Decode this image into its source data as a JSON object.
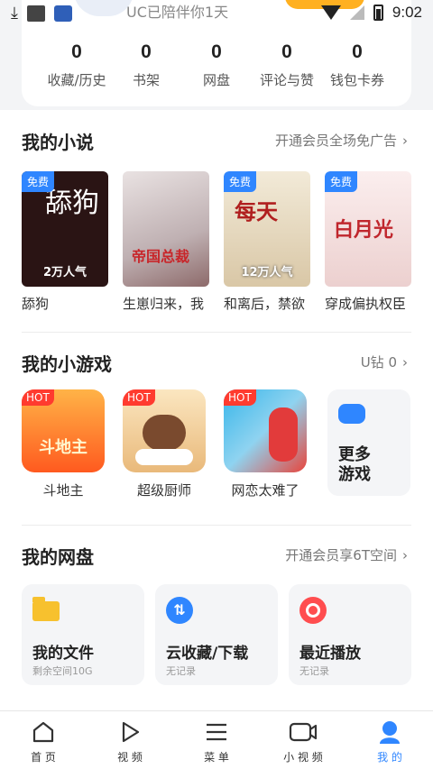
{
  "status_bar": {
    "time": "9:02",
    "app_slogan": "UC已陪伴你1天"
  },
  "stats": [
    {
      "value": "0",
      "label": "收藏/历史"
    },
    {
      "value": "0",
      "label": "书架"
    },
    {
      "value": "0",
      "label": "网盘"
    },
    {
      "value": "0",
      "label": "评论与赞"
    },
    {
      "value": "0",
      "label": "钱包卡券"
    }
  ],
  "novels": {
    "title": "我的小说",
    "more": "开通会员全场免广告",
    "books": [
      {
        "title": "舔狗",
        "badge": "免费",
        "popularity": "2万人气",
        "cover_text": "舔狗",
        "color": "#2a1414"
      },
      {
        "title": "生崽归来，我",
        "badge": "",
        "popularity": "",
        "cover_text": "帝国总裁",
        "color": "#d9cfd0"
      },
      {
        "title": "和离后，禁欲",
        "badge": "免费",
        "popularity": "12万人气",
        "cover_text": "每天",
        "color": "#efe6d6"
      },
      {
        "title": "穿成偏执权臣",
        "badge": "免费",
        "popularity": "",
        "cover_text": "白月光",
        "color": "#f4e3e2"
      }
    ]
  },
  "games": {
    "title": "我的小游戏",
    "more": "U钻 0",
    "items": [
      {
        "name": "斗地主",
        "tag": "HOT",
        "icon_text": "斗地主",
        "color": "#ff7a1a"
      },
      {
        "name": "超级厨师",
        "tag": "HOT",
        "icon_text": "",
        "color": "#f6e0b8"
      },
      {
        "name": "网恋太难了",
        "tag": "HOT",
        "icon_text": "",
        "color": "#3ab3e8"
      }
    ],
    "more_games": "更多游戏"
  },
  "cloud": {
    "title": "我的网盘",
    "more": "开通会员享6T空间",
    "tiles": [
      {
        "name": "我的文件",
        "sub": "剩余空间10G",
        "icon": "folder-icon",
        "color": "#f7c12e"
      },
      {
        "name": "云收藏/下载",
        "sub": "无记录",
        "icon": "cloud-download-icon",
        "color": "#2f86ff"
      },
      {
        "name": "最近播放",
        "sub": "无记录",
        "icon": "recent-play-icon",
        "color": "#ff4d4f"
      }
    ]
  },
  "nav": [
    {
      "label": "首 页",
      "icon": "home-icon"
    },
    {
      "label": "视 频",
      "icon": "play-icon"
    },
    {
      "label": "菜 单",
      "icon": "menu-icon"
    },
    {
      "label": "小 视 频",
      "icon": "camera-icon"
    },
    {
      "label": "我 的",
      "icon": "profile-icon",
      "active": true
    }
  ],
  "colors": {
    "accent": "#2f86ff",
    "hot": "#ff3b2f"
  }
}
